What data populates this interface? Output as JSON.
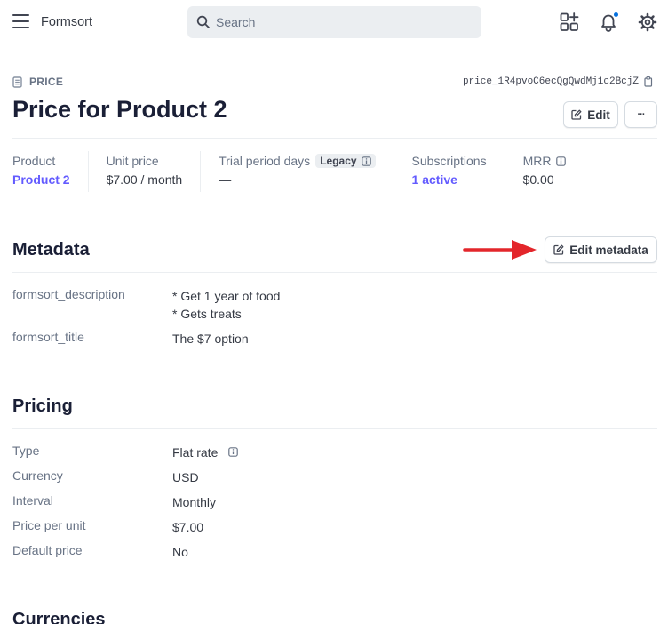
{
  "topbar": {
    "brand": "Formsort",
    "search_placeholder": "Search"
  },
  "header": {
    "kind": "PRICE",
    "price_id": "price_1R4pvoC6ecQgQwdMj1c2BcjZ",
    "title": "Price for Product 2",
    "edit_label": "Edit",
    "more_label": "···"
  },
  "summary": {
    "product_label": "Product",
    "product_value": "Product 2",
    "unit_price_label": "Unit price",
    "unit_price_value": "$7.00 / month",
    "trial_label": "Trial period days",
    "trial_badge": "Legacy",
    "trial_value": "—",
    "subscriptions_label": "Subscriptions",
    "subscriptions_value": "1 active",
    "mrr_label": "MRR",
    "mrr_value": "$0.00"
  },
  "metadata": {
    "title": "Metadata",
    "edit_label": "Edit metadata",
    "rows": [
      {
        "key": "formsort_description",
        "lines": [
          "* Get 1 year of food",
          "* Gets treats"
        ]
      },
      {
        "key": "formsort_title",
        "lines": [
          "The $7 option"
        ]
      }
    ]
  },
  "pricing": {
    "title": "Pricing",
    "rows": [
      {
        "key": "Type",
        "value": "Flat rate"
      },
      {
        "key": "Currency",
        "value": "USD"
      },
      {
        "key": "Interval",
        "value": "Monthly"
      },
      {
        "key": "Price per unit",
        "value": "$7.00"
      },
      {
        "key": "Default price",
        "value": "No"
      }
    ]
  },
  "currencies": {
    "title": "Currencies"
  },
  "colors": {
    "accent": "#635bff",
    "arrow": "#e3262b",
    "notification_dot": "#0570de"
  }
}
